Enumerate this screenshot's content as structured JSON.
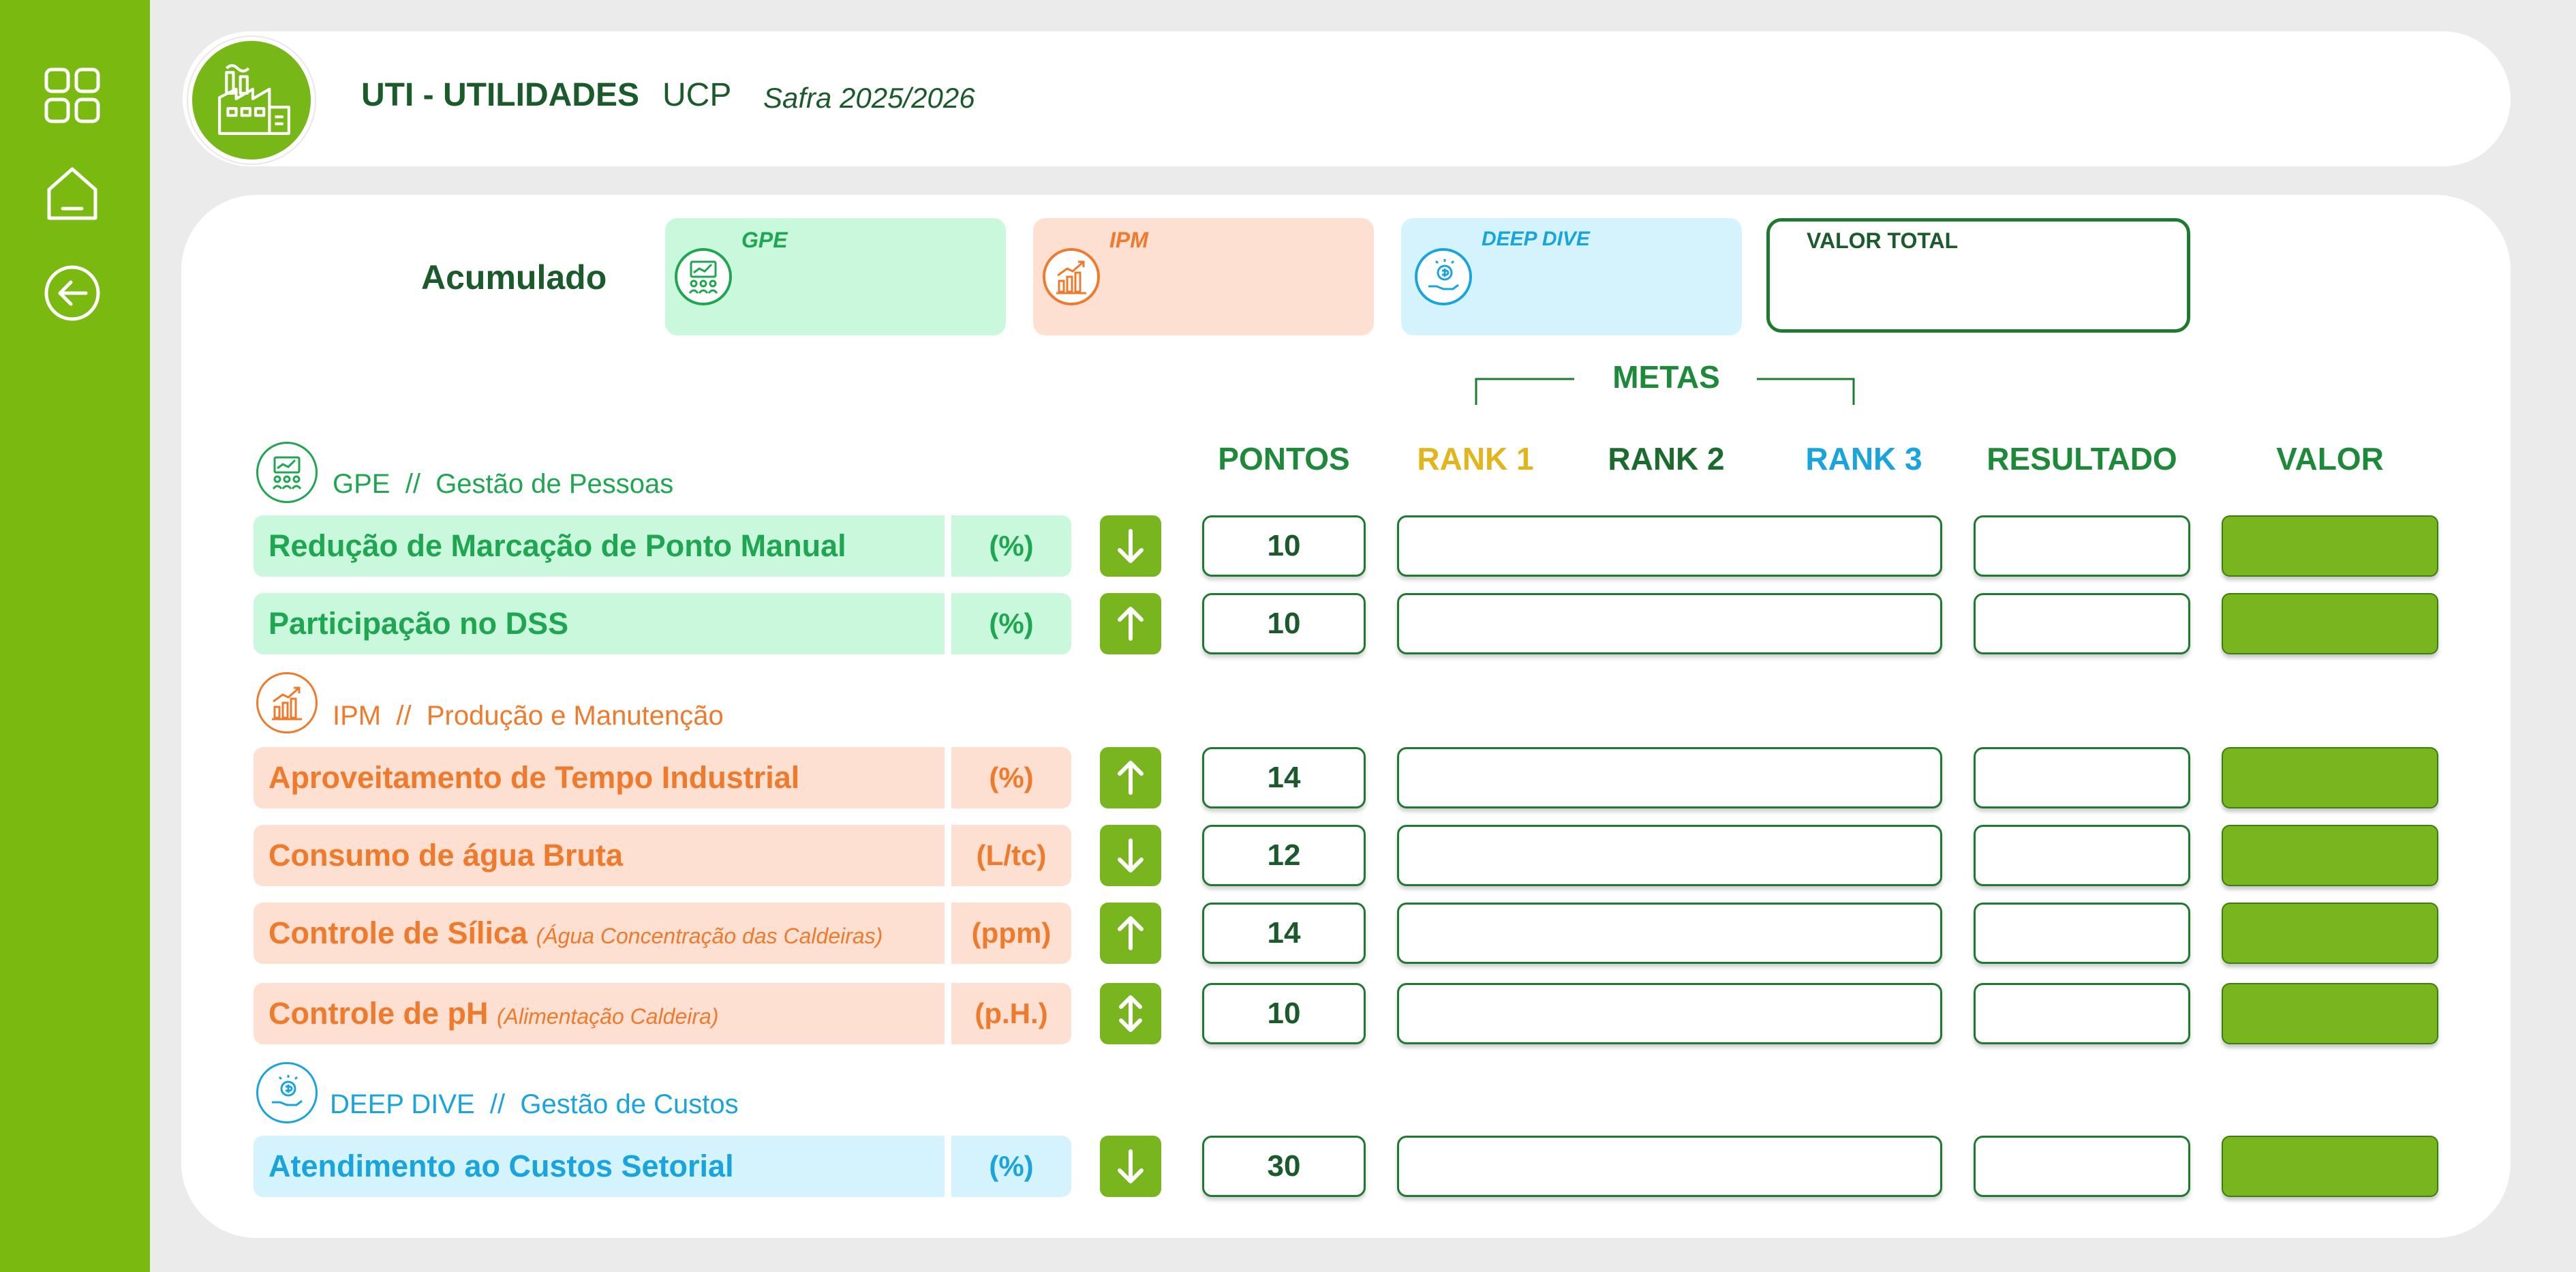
{
  "header": {
    "title": "UTI - UTILIDADES",
    "unit": "UCP",
    "safra": "Safra 2025/2026"
  },
  "sidebar": {
    "icons": [
      "grid-icon",
      "home-icon",
      "back-arrow-icon"
    ]
  },
  "summary": {
    "label": "Acumulado",
    "cards": [
      {
        "label": "GPE",
        "icon": "people-chart-icon"
      },
      {
        "label": "IPM",
        "icon": "growth-chart-icon"
      },
      {
        "label": "DEEP DIVE",
        "icon": "money-hand-icon"
      }
    ],
    "total_label": "VALOR TOTAL"
  },
  "columns": {
    "metas": "METAS",
    "pontos": "PONTOS",
    "rank1": "RANK 1",
    "rank2": "RANK 2",
    "rank3": "RANK 3",
    "resultado": "RESULTADO",
    "valor": "VALOR"
  },
  "sections": {
    "gpe": {
      "code": "GPE",
      "separator": "//",
      "name": "Gestão de Pessoas",
      "rows": [
        {
          "name": "Redução de Marcação de Ponto Manual",
          "unit": "(%)",
          "direction": "down",
          "points": "10"
        },
        {
          "name": "Participação no DSS",
          "unit": "(%)",
          "direction": "up",
          "points": "10"
        }
      ]
    },
    "ipm": {
      "code": "IPM",
      "separator": "//",
      "name": "Produção e Manutenção",
      "rows": [
        {
          "name": "Aproveitamento de Tempo Industrial",
          "unit": "(%)",
          "direction": "up",
          "points": "14"
        },
        {
          "name": "Consumo de água Bruta",
          "unit": "(L/tc)",
          "direction": "down",
          "points": "12"
        },
        {
          "name": "Controle de Sílica",
          "note": "(Água Concentração das Caldeiras)",
          "unit": "(ppm)",
          "direction": "up",
          "points": "14"
        },
        {
          "name": "Controle de pH",
          "note": "(Alimentação Caldeira)",
          "unit": "(p.H.)",
          "direction": "up-down",
          "points": "10"
        }
      ]
    },
    "deep": {
      "code": "DEEP DIVE",
      "separator": "//",
      "name": "Gestão de Custos",
      "rows": [
        {
          "name": "Atendimento ao Custos Setorial",
          "unit": "(%)",
          "direction": "down",
          "points": "30"
        }
      ]
    }
  },
  "colors": {
    "sidebar": "#7aba10",
    "dark_green": "#1b5a2a",
    "gpe": "#1fa651",
    "ipm": "#f07a2c",
    "deep_dive": "#19a4de",
    "rank1": "#e3b51c",
    "valor_fill": "#78b51e"
  }
}
